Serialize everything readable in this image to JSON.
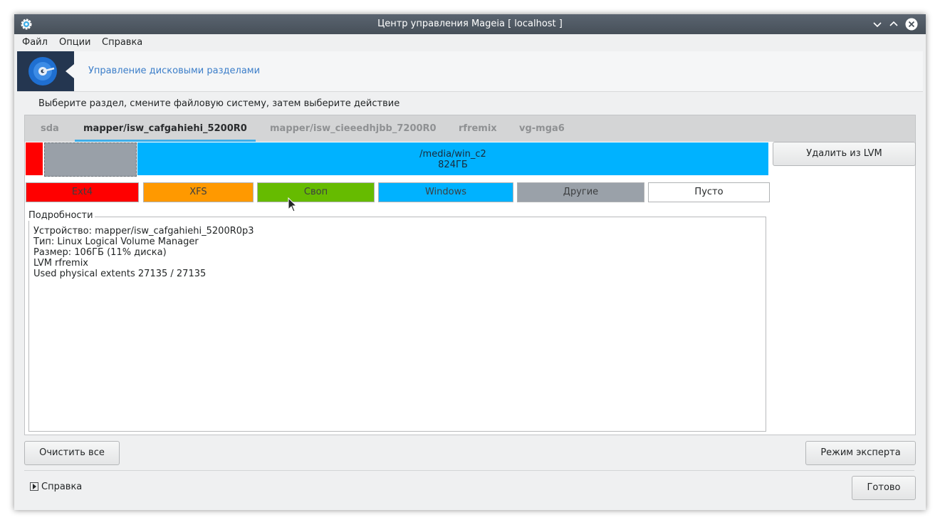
{
  "window": {
    "title": "Центр управления Mageia [ localhost ]"
  },
  "menu": [
    "Файл",
    "Опции",
    "Справка"
  ],
  "header": {
    "title": "Управление дисковыми разделами"
  },
  "instruction": "Выберите раздел, смените файловую систему, затем выберите действие",
  "tabs": [
    "sda",
    "mapper/isw_cafgahiehi_5200R0",
    "mapper/isw_cieeedhjbb_7200R0",
    "rfremix",
    "vg-mga6"
  ],
  "active_tab": "mapper/isw_cafgahiehi_5200R0",
  "partition": {
    "mount": "/media/win_c2",
    "size": "824ГБ"
  },
  "buttons": {
    "remove_lvm": "Удалить из LVM",
    "clear_all": "Очистить все",
    "expert": "Режим эксперта",
    "done": "Готово"
  },
  "legend": [
    {
      "label": "Ext4",
      "color": "#ff0000"
    },
    {
      "label": "XFS",
      "color": "#ff9900"
    },
    {
      "label": "Своп",
      "color": "#66bb00"
    },
    {
      "label": "Windows",
      "color": "#00b2ff"
    },
    {
      "label": "Другие",
      "color": "#9aa1a9"
    },
    {
      "label": "Пусто",
      "color": "#ffffff"
    }
  ],
  "details": {
    "label": "Подробности",
    "lines": [
      "Устройство: mapper/isw_cafgahiehi_5200R0p3",
      "Тип: Linux Logical Volume Manager",
      "Размер: 106ГБ (11% диска)",
      "LVM rfremix",
      "Used physical extents 27135 / 27135"
    ]
  },
  "help": "Справка"
}
